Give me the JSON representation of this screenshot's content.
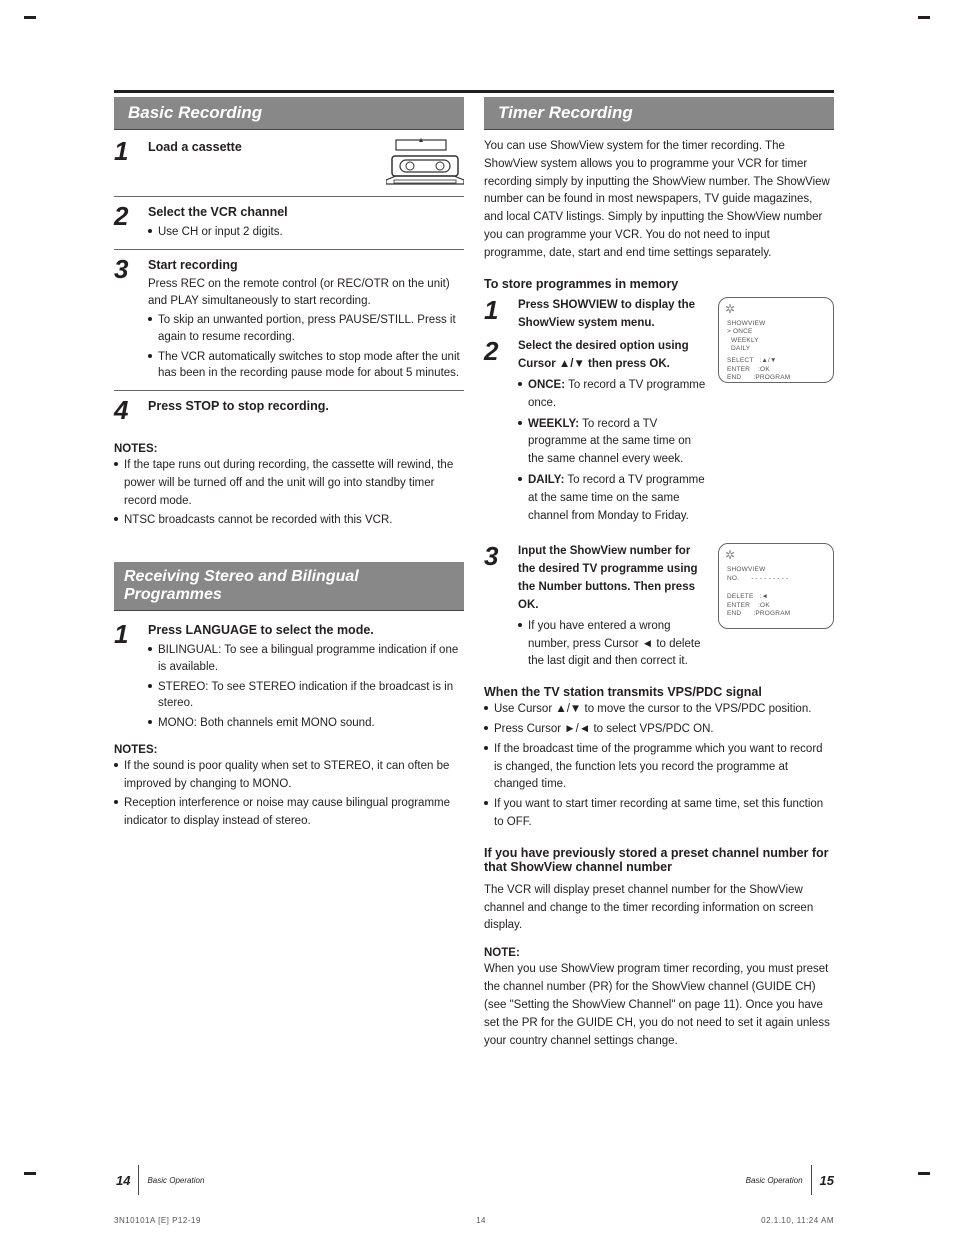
{
  "left": {
    "title": "Basic Recording",
    "step1": {
      "text": "Load a cassette"
    },
    "step2": {
      "lead": "Select the VCR channel",
      "bullet": "Use CH or input 2 digits."
    },
    "step3": {
      "lead": "Start recording",
      "line1": "Press REC on the remote control (or REC/OTR on the unit) and PLAY simultaneously to start recording.",
      "b1": "To skip an unwanted portion, press PAUSE/STILL. Press it again to resume recording.",
      "b2": "The VCR automatically switches to stop mode after the unit has been in the recording pause mode for about 5 minutes."
    },
    "step4": {
      "lead": "Press STOP to stop recording."
    },
    "note_h": "NOTES:",
    "note_b1": "If the tape runs out during recording, the cassette will rewind, the power will be turned off and the unit will go into standby timer record mode.",
    "note_b2": "NTSC broadcasts cannot be recorded with this VCR.",
    "sub_title": "Receiving Stereo and Bilingual Programmes",
    "plain1": "Press LANGUAGE to select the mode.",
    "b_a": "BILINGUAL: To see a bilingual programme indication if one is available.",
    "b_b": "STEREO: To see STEREO indication if the broadcast is in stereo.",
    "b_c": "MONO: Both channels emit MONO sound.",
    "note2_h": "NOTES:",
    "note2_1": "If the sound is poor quality when set to STEREO, it can often be improved by changing to MONO.",
    "note2_2": "Reception interference or noise may cause bilingual programme indicator to display instead of stereo."
  },
  "right": {
    "title": "Timer Recording",
    "intro": "You can use ShowView system for the timer recording. The ShowView system allows you to programme your VCR for timer recording simply by inputting the ShowView number. The ShowView number can be found in most newspapers, TV guide magazines, and local CATV listings. Simply by inputting the ShowView number you can programme your VCR. You do not need to input programme, date, start and end time settings separately.",
    "h_store": "To store programmes in memory",
    "step1": "Press SHOWVIEW to display the ShowView system menu.",
    "step2": "Select the desired option using Cursor ▲/▼ then press OK.",
    "opt_once_l": "ONCE:",
    "opt_once_r": "To record a TV programme once.",
    "opt_weekly_l": "WEEKLY:",
    "opt_weekly_r": "To record a TV programme at the same time on the same channel every week.",
    "opt_daily_l": "DAILY:",
    "opt_daily_r": "To record a TV programme at the same time on the same channel from Monday to Friday.",
    "step3_a": "Input the ShowView number for the desired TV programme using the Number buttons. Then press OK.",
    "step3_b": "If you have entered a wrong number, press Cursor ◄ to delete the last digit and then correct it.",
    "box1": {
      "l1": "SHOWVIEW",
      "l2": "> ONCE",
      "l3": "  WEEKLY",
      "l4": "  DAILY",
      "l5": "SELECT   :▲/▼",
      "l6": "ENTER    :OK",
      "l7": "END      :PROGRAM"
    },
    "box2": {
      "l1": "SHOWVIEW",
      "l2": "NO.      - - - - - - - - -",
      "l3": "DELETE   :◄",
      "l4": "ENTER    :OK",
      "l5": "END      :PROGRAM"
    },
    "h_vps": "When the TV station transmits VPS/PDC signal",
    "vps1": "Use Cursor ▲/▼ to move the cursor to the VPS/PDC position.",
    "vps2": "Press Cursor ►/◄ to select VPS/PDC ON.",
    "vps3": "If the broadcast time of the programme which you want to record is changed, the function lets you record the programme at changed time.",
    "vps4": "If you want to start timer recording at same time, set this function to OFF.",
    "h_prev": "If you have previously stored a preset channel number for that ShowView channel number",
    "prev_body": "The VCR will display preset channel number for the ShowView channel and change to the timer recording information on screen display.",
    "note_h": "NOTE:",
    "note_body": "When you use ShowView program timer recording, you must preset the channel number (PR) for the ShowView channel (GUIDE CH) (see \"Setting the ShowView Channel\" on page 11). Once you have set the PR for the GUIDE CH, you do not need to set it again unless your country channel settings change."
  },
  "footer": {
    "page_l": "14",
    "page_r": "15",
    "area_l": "Basic Operation",
    "area_r": "Basic Operation",
    "meta_l": "3N10101A   [E]   P12-19",
    "meta_c": "14",
    "meta_r": "02.1.10, 11:24 AM"
  }
}
